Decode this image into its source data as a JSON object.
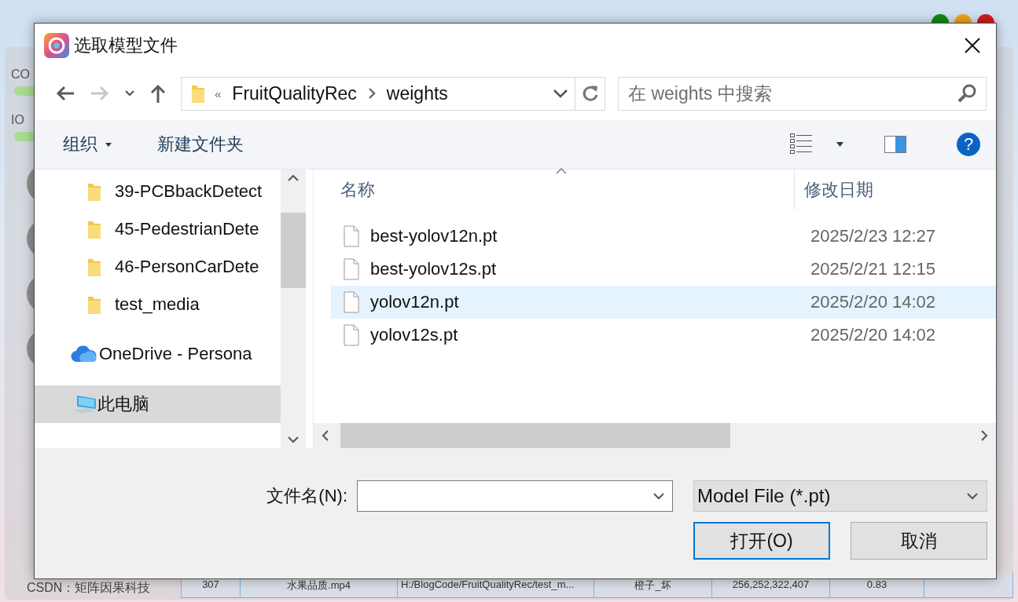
{
  "background_app": {
    "panel_labels": [
      "CO",
      "IO"
    ],
    "table_row": [
      "307",
      "水果品质.mp4",
      "H:/BlogCode/FruitQualityRec/test_m...",
      "橙子_坏",
      "256,252,322,407",
      "0.83"
    ],
    "footer": "CSDN：矩阵因果科技"
  },
  "dialog": {
    "title": "选取模型文件",
    "address": {
      "overflow_mark": "«",
      "path": [
        "FruitQualityRec",
        "weights"
      ]
    },
    "search": {
      "placeholder": "在 weights 中搜索"
    },
    "toolbar": {
      "organize": "组织",
      "new_folder": "新建文件夹",
      "help": "?"
    },
    "sidebar": {
      "items": [
        {
          "label": "39-PCBbackDetect",
          "kind": "folder",
          "selected": false
        },
        {
          "label": "45-PedestrianDete",
          "kind": "folder",
          "selected": false
        },
        {
          "label": "46-PersonCarDete",
          "kind": "folder",
          "selected": false
        },
        {
          "label": "test_media",
          "kind": "folder",
          "selected": false
        },
        {
          "label": "OneDrive - Persona",
          "kind": "cloud",
          "selected": false
        },
        {
          "label": "此电脑",
          "kind": "computer",
          "selected": true
        }
      ]
    },
    "columns": [
      "名称",
      "修改日期"
    ],
    "files": [
      {
        "name": "best-yolov12n.pt",
        "modified": "2025/2/23 12:27",
        "selected": false
      },
      {
        "name": "best-yolov12s.pt",
        "modified": "2025/2/21 12:15",
        "selected": false
      },
      {
        "name": "yolov12n.pt",
        "modified": "2025/2/20 14:02",
        "selected": true
      },
      {
        "name": "yolov12s.pt",
        "modified": "2025/2/20 14:02",
        "selected": false
      }
    ],
    "filename_label": "文件名(N):",
    "file_type": "Model File (*.pt)",
    "buttons": [
      {
        "label": "打开(O)",
        "default": true
      },
      {
        "label": "取消",
        "default": false
      }
    ]
  }
}
